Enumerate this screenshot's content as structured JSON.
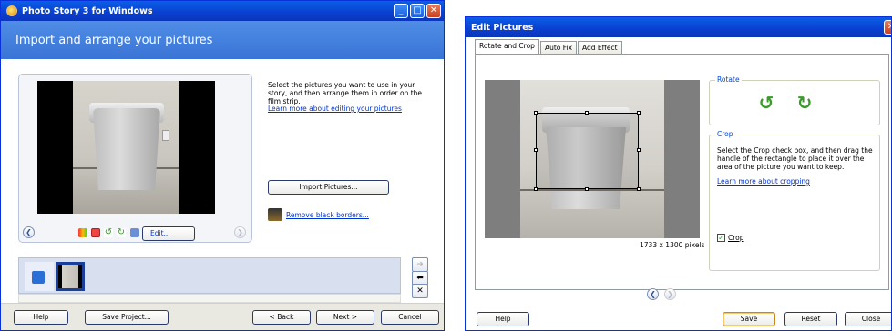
{
  "window1": {
    "title": "Photo Story 3 for Windows",
    "header": "Import and arrange your pictures",
    "instructions": "Select the pictures you want to use in your story, and then arrange them in order on the film strip.",
    "learn_link": "Learn more about editing your pictures",
    "import_button": "Import Pictures...",
    "remove_borders_link": "Remove black borders...",
    "edit_button": "Edit...",
    "buttons": {
      "help": "Help",
      "save_project": "Save Project...",
      "back": "< Back",
      "next": "Next >",
      "cancel": "Cancel"
    }
  },
  "window2": {
    "title": "Edit Pictures",
    "tabs": [
      "Rotate and Crop",
      "Auto Fix",
      "Add Effect"
    ],
    "rotate_label": "Rotate",
    "crop_label": "Crop",
    "crop_instructions": "Select the Crop check box, and then drag the handle of the rectangle to place it over the area of the picture you want to keep.",
    "crop_link": "Learn more about cropping",
    "crop_checkbox": "Crop",
    "dimensions": "1733 x 1300 pixels",
    "buttons": {
      "help": "Help",
      "save": "Save",
      "reset": "Reset",
      "close": "Close"
    }
  },
  "colors": {
    "title_blue": "#0a3fd0",
    "header_blue": "#3a74d6",
    "link": "#0033cc",
    "rotate_green": "#3a9a2a"
  }
}
